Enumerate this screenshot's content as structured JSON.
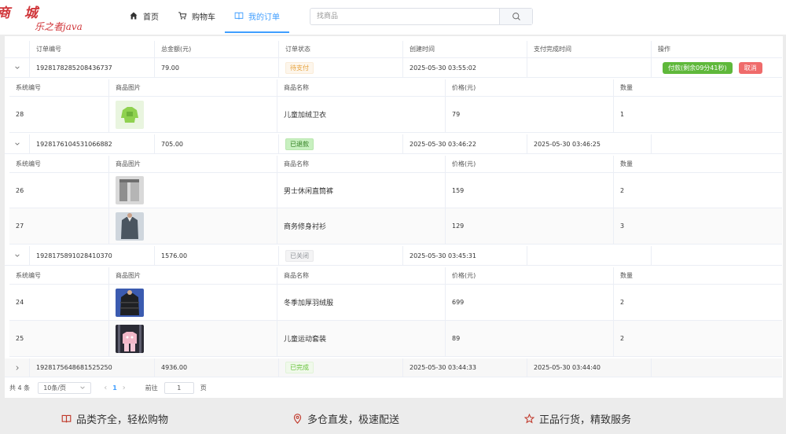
{
  "header": {
    "logo_title": "商 城",
    "logo_subtitle": "乐之者java",
    "nav": [
      {
        "label": "首页",
        "icon": "home-icon"
      },
      {
        "label": "购物车",
        "icon": "cart-icon"
      },
      {
        "label": "我的订单",
        "icon": "book-icon"
      }
    ],
    "search": {
      "placeholder": "找商品",
      "value": ""
    }
  },
  "orders_table": {
    "columns": [
      "订单编号",
      "总金额(元)",
      "订单状态",
      "创建时间",
      "支付完成时间",
      "操作"
    ],
    "item_columns": [
      "系统编号",
      "商品图片",
      "商品名称",
      "价格(元)",
      "数量"
    ],
    "actions": {
      "pay": "付款(剩余09分41秒)",
      "cancel": "取消"
    },
    "orders": [
      {
        "order_no": "1928178285208436737",
        "total": "79.00",
        "status": "待支付",
        "created": "2025-05-30 03:55:02",
        "paid": "",
        "items": [
          {
            "id": "28",
            "name": "儿童加绒卫衣",
            "price": "79",
            "qty": "1"
          }
        ]
      },
      {
        "order_no": "1928176104531066882",
        "total": "705.00",
        "status": "已退款",
        "created": "2025-05-30 03:46:22",
        "paid": "2025-05-30 03:46:25",
        "items": [
          {
            "id": "26",
            "name": "男士休闲直筒裤",
            "price": "159",
            "qty": "2"
          },
          {
            "id": "27",
            "name": "商务修身衬衫",
            "price": "129",
            "qty": "3"
          }
        ]
      },
      {
        "order_no": "1928175891028410370",
        "total": "1576.00",
        "status": "已关闭",
        "created": "2025-05-30 03:45:31",
        "paid": "",
        "items": [
          {
            "id": "24",
            "name": "冬季加厚羽绒服",
            "price": "699",
            "qty": "2"
          },
          {
            "id": "25",
            "name": "儿童运动套装",
            "price": "89",
            "qty": "2"
          }
        ]
      },
      {
        "order_no": "1928175648681525250",
        "total": "4936.00",
        "status": "已完成",
        "created": "2025-05-30 03:44:33",
        "paid": "2025-05-30 03:44:40",
        "items": []
      }
    ]
  },
  "pagination": {
    "total": "共 4 条",
    "page_size": "10条/页",
    "current_page": "1",
    "goto_label": "前往",
    "goto_value": "1",
    "page_suffix": "页"
  },
  "footer": {
    "features": [
      {
        "label": "品类齐全，轻松购物",
        "icon": "book-icon"
      },
      {
        "label": "多仓直发，极速配送",
        "icon": "location-pin-icon"
      },
      {
        "label": "正品行货，精致服务",
        "icon": "star-icon"
      }
    ],
    "accent": "#c0392b"
  }
}
